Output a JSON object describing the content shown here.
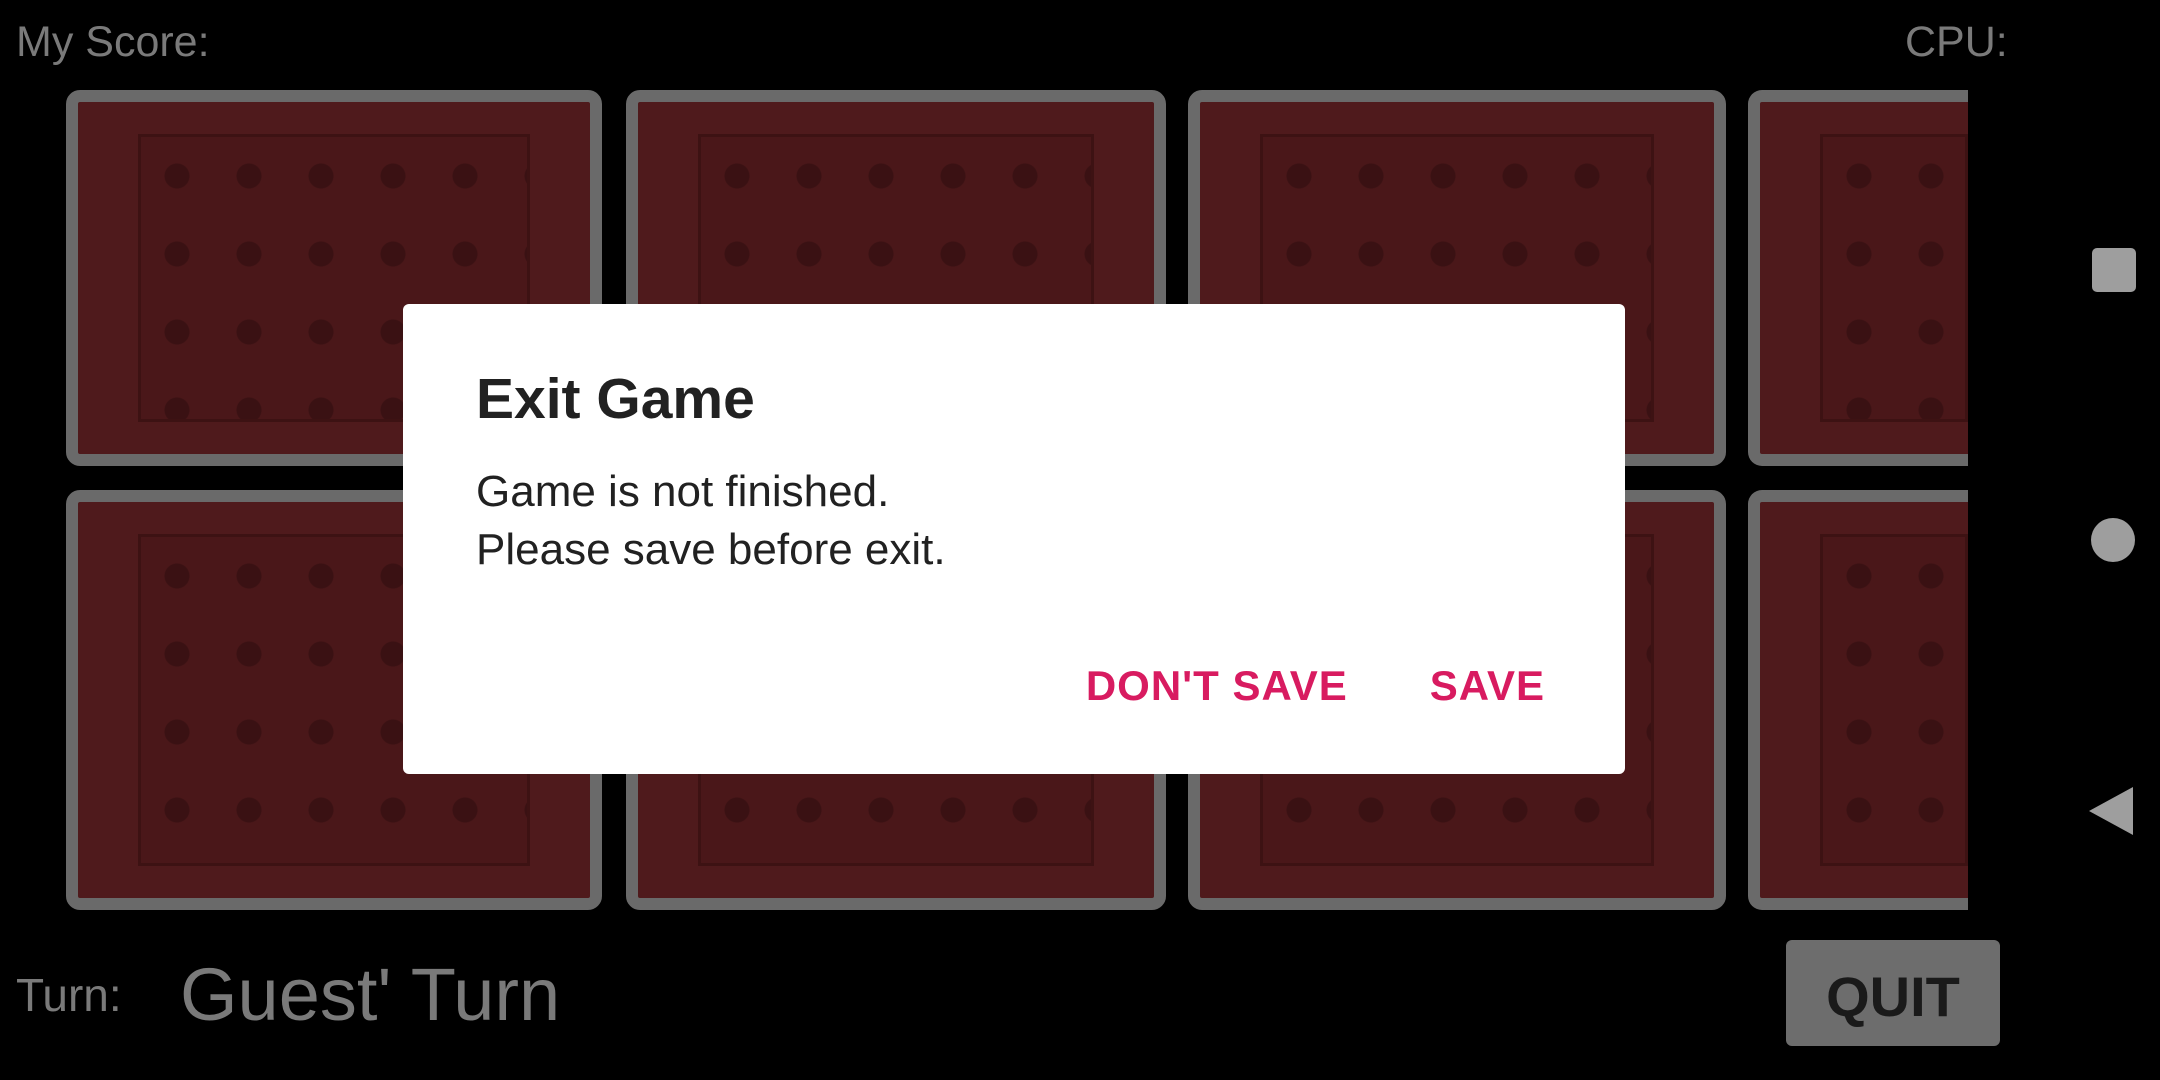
{
  "header": {
    "my_score_label": "My Score:",
    "cpu_label": "CPU:"
  },
  "board": {
    "rows": 2,
    "visible_columns": 4,
    "card_state": "face-down"
  },
  "footer": {
    "turn_label": "Turn:",
    "turn_value": "Guest' Turn",
    "quit_label": "QUIT"
  },
  "dialog": {
    "title": "Exit Game",
    "message": "Game is not finished.\nPlease save before exit.",
    "dont_save_label": "DON'T SAVE",
    "save_label": "SAVE",
    "accent_color": "#d81b60"
  },
  "navbar": {
    "icons": [
      "recents-icon",
      "home-icon",
      "back-icon"
    ]
  }
}
